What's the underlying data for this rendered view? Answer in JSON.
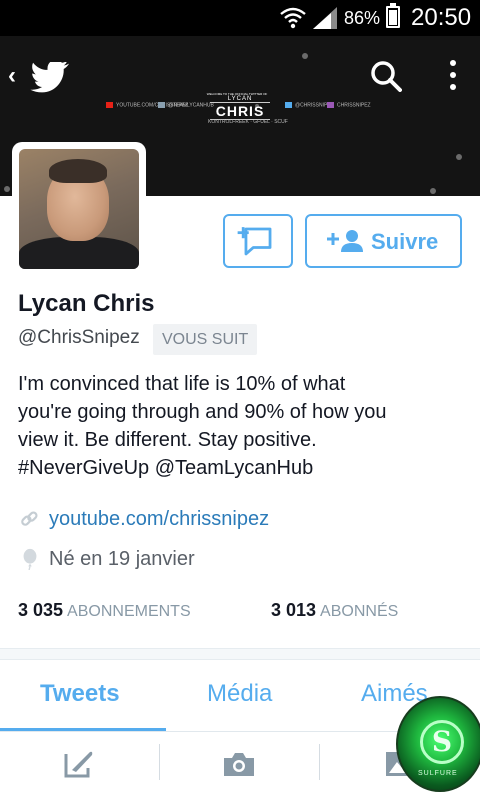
{
  "status_bar": {
    "battery_percent": "86%",
    "battery_level": 0.86,
    "time": "20:50"
  },
  "banner": {
    "welcome": "WELCOME TO THE OFFICIAL TWITTER OF",
    "brand_top": "LYCAN",
    "brand_name": "CHRIS",
    "social_links": [
      "YOUTUBE.COM/CHRISSNIPEZ",
      "@TEAMLYCANHUB",
      "@CHRISSNIPEZ",
      "CHRISSNIPEZ"
    ],
    "sponsors": "KONTROLFREEK  ·  GFUEL  ·  SCUF"
  },
  "actions": {
    "follow_label": "Suivre"
  },
  "profile": {
    "name": "Lycan Chris",
    "handle": "@ChrisSnipez",
    "follows_you": "VOUS SUIT",
    "bio_lines": [
      "I'm convinced that life is 10% of what",
      "you're going through and 90% of how you",
      "view it. Be different. Stay positive.",
      "#NeverGiveUp @TeamLycanHub"
    ],
    "url": "youtube.com/chrissnipez",
    "birthday": "Né en 19 janvier"
  },
  "stats": {
    "following_count": "3 035",
    "following_label": "ABONNEMENTS",
    "followers_count": "3 013",
    "followers_label": "ABONNÉS"
  },
  "tabs": [
    {
      "label": "Tweets",
      "active": true
    },
    {
      "label": "Média",
      "active": false
    },
    {
      "label": "Aimés",
      "active": false
    }
  ],
  "overlay_badge": {
    "glyph": "S",
    "caption": "SULFURE"
  },
  "colors": {
    "accent": "#55acee",
    "link": "#2b7bb9",
    "text": "#141823",
    "muted": "#8899a6"
  },
  "icons": [
    "wifi-icon",
    "signal-icon",
    "battery-icon",
    "back-icon",
    "twitter-bird-icon",
    "search-icon",
    "more-icon",
    "direct-message-icon",
    "add-user-icon",
    "link-icon",
    "birthday-balloon-icon",
    "compose-tweet-icon",
    "camera-icon",
    "image-icon"
  ]
}
